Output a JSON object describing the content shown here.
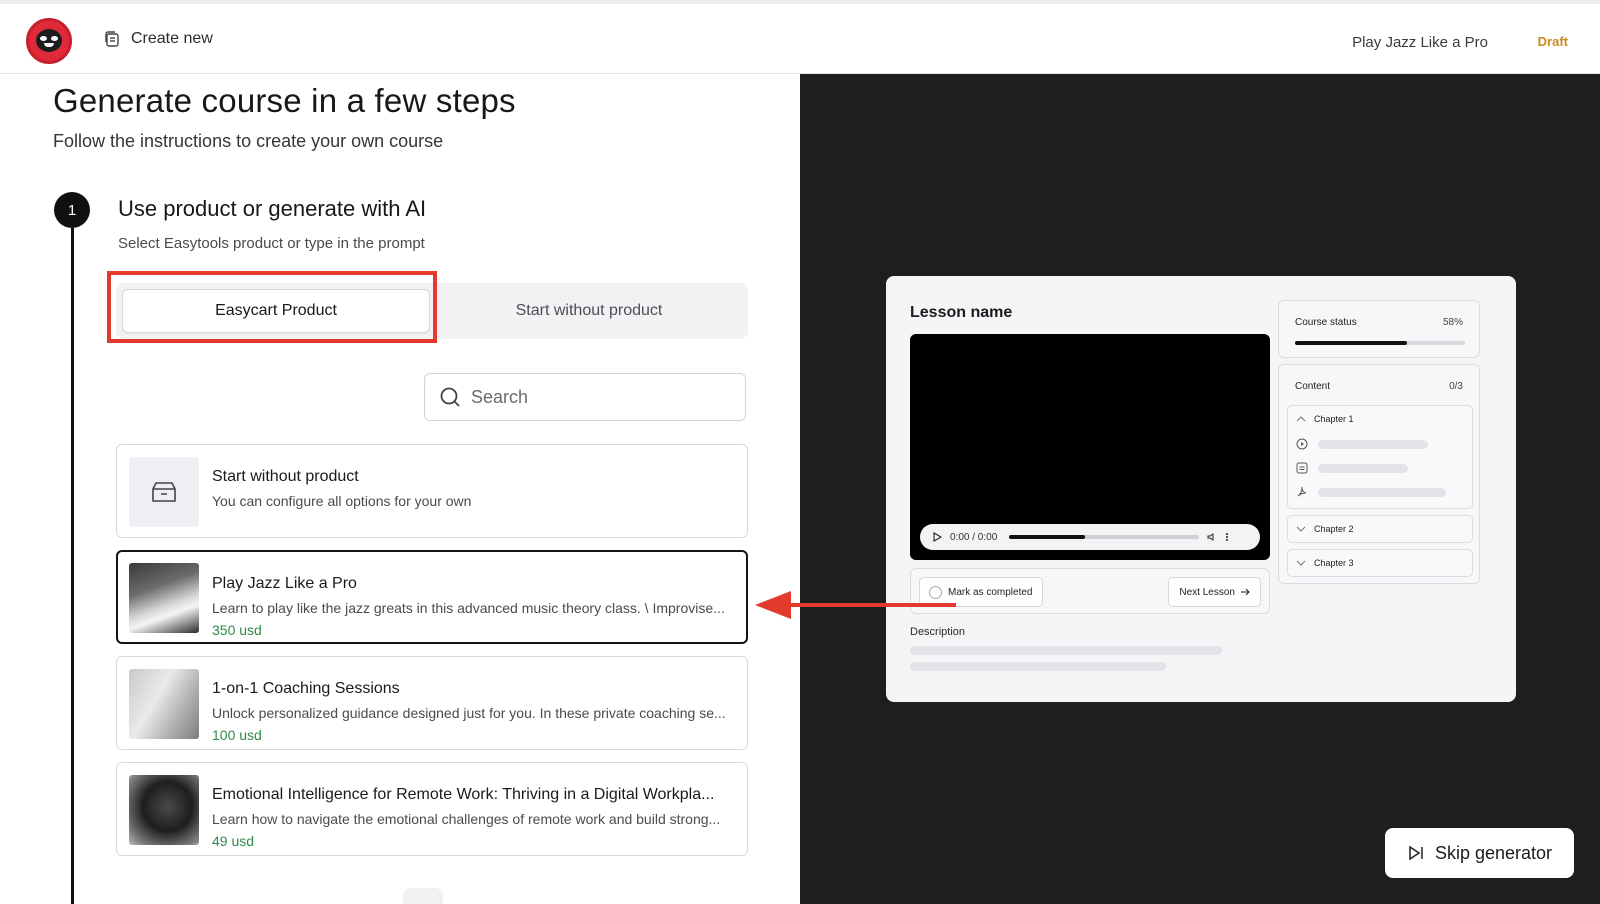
{
  "header": {
    "create_new_label": "Create new",
    "course_title": "Play Jazz Like a Pro",
    "status_badge": "Draft"
  },
  "page": {
    "title": "Generate course in a few steps",
    "subtitle": "Follow the instructions to create your own course"
  },
  "step1": {
    "number": "1",
    "title": "Use product or generate with AI",
    "subtitle": "Select Easytools product or type in the prompt",
    "tabs": [
      {
        "label": "Easycart Product",
        "active": true
      },
      {
        "label": "Start without product",
        "active": false
      }
    ],
    "search_placeholder": "Search",
    "products": [
      {
        "title": "Start without product",
        "description": "You can configure all options for your own",
        "price": ""
      },
      {
        "title": "Play Jazz Like a Pro",
        "description": "Learn to play like the jazz greats in this advanced music theory class. \\ Improvise...",
        "price": "350 usd",
        "selected": true
      },
      {
        "title": "1-on-1 Coaching Sessions",
        "description": "Unlock personalized guidance designed just for you. In these private coaching se...",
        "price": "100 usd"
      },
      {
        "title": "Emotional Intelligence for Remote Work: Thriving in a Digital Workpla...",
        "description": "Learn how to navigate the emotional challenges of remote work and build strong...",
        "price": "49 usd"
      }
    ]
  },
  "preview": {
    "lesson_name": "Lesson name",
    "video_time": "0:00 / 0:00",
    "video_progress": 0.4,
    "mark_completed_label": "Mark as completed",
    "next_lesson_label": "Next Lesson",
    "description_label": "Description",
    "course_status_label": "Course status",
    "course_status_pct": "58%",
    "course_status_value": 0.66,
    "content_label": "Content",
    "content_count": "0/3",
    "chapters": [
      {
        "name": "Chapter 1",
        "expanded": true
      },
      {
        "name": "Chapter 2",
        "expanded": false
      },
      {
        "name": "Chapter 3",
        "expanded": false
      }
    ]
  },
  "skip_label": "Skip generator",
  "colors": {
    "accent_red": "#e23a2c",
    "price_green": "#2f8a48",
    "draft_orange": "#c98a1d",
    "right_panel_bg": "#1e1e20"
  }
}
